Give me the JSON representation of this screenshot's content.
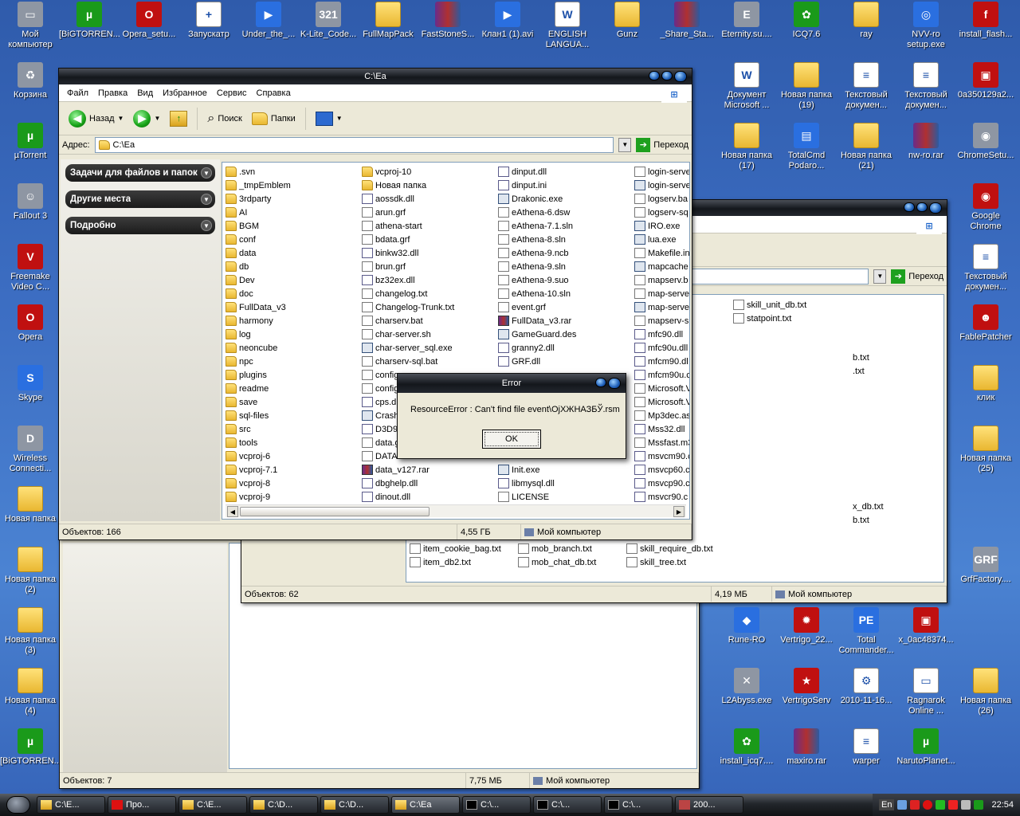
{
  "desktop": {
    "icons": [
      {
        "label": "Мой компьютер",
        "icon": "computer-icon",
        "cls": "gray",
        "glyph": "▭"
      },
      {
        "label": "[BiGTORREN...",
        "icon": "utorrent-icon",
        "cls": "green",
        "glyph": "µ"
      },
      {
        "label": "Opera_setu...",
        "icon": "opera-installer-icon",
        "cls": "red",
        "glyph": "O"
      },
      {
        "label": "Запускатр",
        "icon": "launcher-icon",
        "cls": "doc",
        "glyph": "+"
      },
      {
        "label": "Under_the_...",
        "icon": "media-file-icon",
        "cls": "blue",
        "glyph": "▶"
      },
      {
        "label": "K-Lite_Code...",
        "icon": "klite-icon",
        "cls": "gray",
        "glyph": "321"
      },
      {
        "label": "FullMapPack",
        "icon": "folder-icon",
        "cls": "folder",
        "glyph": ""
      },
      {
        "label": "FastStoneS...",
        "icon": "winrar-icon",
        "cls": "rar",
        "glyph": ""
      },
      {
        "label": "Клан1 (1).avi",
        "icon": "media-file-icon",
        "cls": "blue",
        "glyph": "▶"
      },
      {
        "label": "ENGLISH LANGUA...",
        "icon": "word-doc-icon",
        "cls": "doc",
        "glyph": "W"
      },
      {
        "label": "Gunz",
        "icon": "folder-icon",
        "cls": "folder",
        "glyph": ""
      },
      {
        "label": "_Share_Sta...",
        "icon": "winrar-icon",
        "cls": "rar",
        "glyph": ""
      },
      {
        "label": "Eternity.su....",
        "icon": "eternity-icon",
        "cls": "gray",
        "glyph": "E"
      },
      {
        "label": "ICQ7.6",
        "icon": "icq-icon",
        "cls": "green",
        "glyph": "✿"
      },
      {
        "label": "ray",
        "icon": "folder-icon",
        "cls": "folder",
        "glyph": ""
      },
      {
        "label": "NVV-ro setup.exe",
        "icon": "disc-icon",
        "cls": "blue",
        "glyph": "◎"
      },
      {
        "label": "install_flash...",
        "icon": "flash-icon",
        "cls": "red",
        "glyph": "f"
      },
      {
        "label": "Корзина",
        "icon": "recycle-bin-icon",
        "cls": "gray",
        "glyph": "♻"
      },
      {
        "label": "µTorrent",
        "icon": "utorrent-icon",
        "cls": "green",
        "glyph": "µ"
      },
      {
        "label": "Fallout 3",
        "icon": "fallout-icon",
        "cls": "gray",
        "glyph": "☺"
      },
      {
        "label": "Freemake Video C...",
        "icon": "freemake-icon",
        "cls": "red",
        "glyph": "V"
      },
      {
        "label": "Opera",
        "icon": "opera-icon",
        "cls": "red",
        "glyph": "O"
      },
      {
        "label": "Skype",
        "icon": "skype-icon",
        "cls": "blue",
        "glyph": "S"
      },
      {
        "label": "Wireless Connecti...",
        "icon": "dlink-icon",
        "cls": "gray",
        "glyph": "D"
      },
      {
        "label": "Новая папка",
        "icon": "folder-icon",
        "cls": "folder",
        "glyph": ""
      },
      {
        "label": "Новая папка (2)",
        "icon": "folder-icon",
        "cls": "folder",
        "glyph": ""
      },
      {
        "label": "Новая папка (3)",
        "icon": "folder-icon",
        "cls": "folder",
        "glyph": ""
      },
      {
        "label": "Новая папка (4)",
        "icon": "folder-icon",
        "cls": "folder",
        "glyph": ""
      },
      {
        "label": "[BiGTORREN...",
        "icon": "utorrent-icon",
        "cls": "green",
        "glyph": "µ"
      },
      {
        "label": "Документ Microsoft ...",
        "icon": "word-doc-icon",
        "cls": "doc",
        "glyph": "W"
      },
      {
        "label": "Новая папка (19)",
        "icon": "folder-icon",
        "cls": "folder",
        "glyph": ""
      },
      {
        "label": "Текстовый докумен...",
        "icon": "text-doc-icon",
        "cls": "doc",
        "glyph": "≡"
      },
      {
        "label": "Текстовый докумен...",
        "icon": "text-doc-icon",
        "cls": "doc",
        "glyph": "≡"
      },
      {
        "label": "0a350129a2...",
        "icon": "image-icon",
        "cls": "red",
        "glyph": "▣"
      },
      {
        "label": "Новая папка (17)",
        "icon": "folder-icon",
        "cls": "folder",
        "glyph": ""
      },
      {
        "label": "TotalCmd Podaro...",
        "icon": "floppy-icon",
        "cls": "blue",
        "glyph": "▤"
      },
      {
        "label": "Новая папка (21)",
        "icon": "folder-icon",
        "cls": "folder",
        "glyph": ""
      },
      {
        "label": "nw-ro.rar",
        "icon": "winrar-icon",
        "cls": "rar",
        "glyph": ""
      },
      {
        "label": "ChromeSetu...",
        "icon": "chrome-setup-icon",
        "cls": "gray",
        "glyph": "◉"
      },
      {
        "label": "Google Chrome",
        "icon": "chrome-icon",
        "cls": "red",
        "glyph": "◉"
      },
      {
        "label": "Текстовый докумен...",
        "icon": "text-doc-icon",
        "cls": "doc",
        "glyph": "≡"
      },
      {
        "label": "FablePatcher",
        "icon": "fable-icon",
        "cls": "red",
        "glyph": "☻"
      },
      {
        "label": "клик",
        "icon": "folder-icon",
        "cls": "folder",
        "glyph": ""
      },
      {
        "label": "Новая папка (25)",
        "icon": "folder-icon",
        "cls": "folder",
        "glyph": ""
      },
      {
        "label": "GrfFactory....",
        "icon": "grf-icon",
        "cls": "gray",
        "glyph": "GRF"
      },
      {
        "label": "Rune-RO",
        "icon": "rune-icon",
        "cls": "blue",
        "glyph": "◆"
      },
      {
        "label": "Vertrigo_22...",
        "icon": "gear-icon",
        "cls": "red",
        "glyph": "✹"
      },
      {
        "label": "Total Commander...",
        "icon": "pe-icon",
        "cls": "blue",
        "glyph": "PE"
      },
      {
        "label": "x_0ac48374...",
        "icon": "image-icon",
        "cls": "red",
        "glyph": "▣"
      },
      {
        "label": "L2Abyss.exe",
        "icon": "l2-icon",
        "cls": "gray",
        "glyph": "✕"
      },
      {
        "label": "VertrigoServ",
        "icon": "vertrigo-icon",
        "cls": "red",
        "glyph": "★"
      },
      {
        "label": "2010-11-16...",
        "icon": "settings-file-icon",
        "cls": "doc",
        "glyph": "⚙"
      },
      {
        "label": "Ragnarok Online ...",
        "icon": "window-icon",
        "cls": "doc",
        "glyph": "▭"
      },
      {
        "label": "Новая папка (26)",
        "icon": "folder-icon",
        "cls": "folder",
        "glyph": ""
      },
      {
        "label": "install_icq7....",
        "icon": "icq-icon",
        "cls": "green",
        "glyph": "✿"
      },
      {
        "label": "maxiro.rar",
        "icon": "winrar-icon",
        "cls": "rar",
        "glyph": ""
      },
      {
        "label": "warper",
        "icon": "text-doc-icon",
        "cls": "doc",
        "glyph": "≡"
      },
      {
        "label": "NarutoPlanet...",
        "icon": "utorrent-icon",
        "cls": "green",
        "glyph": "µ"
      }
    ]
  },
  "explorer_main": {
    "title": "C:\\Ea",
    "menu": [
      "Файл",
      "Правка",
      "Вид",
      "Избранное",
      "Сервис",
      "Справка"
    ],
    "back_label": "Назад",
    "search_label": "Поиск",
    "folders_label": "Папки",
    "address_label": "Адрес:",
    "address_value": "C:\\Ea",
    "go_label": "Переход",
    "task_sections": [
      "Задачи для файлов и папок",
      "Другие места",
      "Подробно"
    ],
    "columns": [
      [
        {
          "n": ".svn",
          "t": "folder"
        },
        {
          "n": "_tmpEmblem",
          "t": "folder"
        },
        {
          "n": "3rdparty",
          "t": "folder"
        },
        {
          "n": "AI",
          "t": "folder"
        },
        {
          "n": "BGM",
          "t": "folder"
        },
        {
          "n": "conf",
          "t": "folder"
        },
        {
          "n": "data",
          "t": "folder"
        },
        {
          "n": "db",
          "t": "folder"
        },
        {
          "n": "Dev",
          "t": "folder"
        },
        {
          "n": "doc",
          "t": "folder"
        },
        {
          "n": "FullData_v3",
          "t": "folder"
        },
        {
          "n": "harmony",
          "t": "folder"
        },
        {
          "n": "log",
          "t": "folder"
        },
        {
          "n": "neoncube",
          "t": "folder"
        },
        {
          "n": "npc",
          "t": "folder"
        },
        {
          "n": "plugins",
          "t": "folder"
        },
        {
          "n": "readme",
          "t": "folder"
        },
        {
          "n": "save",
          "t": "folder"
        },
        {
          "n": "sql-files",
          "t": "folder"
        },
        {
          "n": "src",
          "t": "folder"
        },
        {
          "n": "tools",
          "t": "folder"
        },
        {
          "n": "vcproj-6",
          "t": "folder"
        },
        {
          "n": "vcproj-7.1",
          "t": "folder"
        },
        {
          "n": "vcproj-8",
          "t": "folder"
        },
        {
          "n": "vcproj-9",
          "t": "folder"
        }
      ],
      [
        {
          "n": "vcproj-10",
          "t": "folder"
        },
        {
          "n": "Новая папка",
          "t": "folder"
        },
        {
          "n": "aossdk.dll",
          "t": "dll"
        },
        {
          "n": "arun.grf",
          "t": "file"
        },
        {
          "n": "athena-start",
          "t": "file"
        },
        {
          "n": "bdata.grf",
          "t": "file"
        },
        {
          "n": "binkw32.dll",
          "t": "dll"
        },
        {
          "n": "brun.grf",
          "t": "file"
        },
        {
          "n": "bz32ex.dll",
          "t": "dll"
        },
        {
          "n": "changelog.txt",
          "t": "file"
        },
        {
          "n": "Changelog-Trunk.txt",
          "t": "file"
        },
        {
          "n": "charserv.bat",
          "t": "file"
        },
        {
          "n": "char-server.sh",
          "t": "file"
        },
        {
          "n": "char-server_sql.exe",
          "t": "exe"
        },
        {
          "n": "charserv-sql.bat",
          "t": "file"
        },
        {
          "n": "configure",
          "t": "file"
        },
        {
          "n": "config",
          "t": "file"
        },
        {
          "n": "cps.dll",
          "t": "dll"
        },
        {
          "n": "Crash",
          "t": "exe"
        },
        {
          "n": "D3D9",
          "t": "dll"
        },
        {
          "n": "data.grf",
          "t": "file"
        },
        {
          "n": "DATA",
          "t": "file"
        },
        {
          "n": "data_v127.rar",
          "t": "rar"
        },
        {
          "n": "dbghelp.dll",
          "t": "dll"
        },
        {
          "n": "dinout.dll",
          "t": "dll"
        }
      ],
      [
        {
          "n": "dinput.dll",
          "t": "dll"
        },
        {
          "n": "dinput.ini",
          "t": "dll"
        },
        {
          "n": "Drakonic.exe",
          "t": "exe"
        },
        {
          "n": "eAthena-6.dsw",
          "t": "file"
        },
        {
          "n": "eAthena-7.1.sln",
          "t": "file"
        },
        {
          "n": "eAthena-8.sln",
          "t": "file"
        },
        {
          "n": "eAthena-9.ncb",
          "t": "file"
        },
        {
          "n": "eAthena-9.sln",
          "t": "file"
        },
        {
          "n": "eAthena-9.suo",
          "t": "file"
        },
        {
          "n": "eAthena-10.sln",
          "t": "file"
        },
        {
          "n": "event.grf",
          "t": "file"
        },
        {
          "n": "FullData_v3.rar",
          "t": "rar"
        },
        {
          "n": "GameGuard.des",
          "t": "exe"
        },
        {
          "n": "granny2.dll",
          "t": "dll"
        },
        {
          "n": "GRF.dll",
          "t": "dll"
        },
        {
          "n": "",
          "t": "none"
        },
        {
          "n": "",
          "t": "none"
        },
        {
          "n": "",
          "t": "none"
        },
        {
          "n": "",
          "t": "none"
        },
        {
          "n": "",
          "t": "none"
        },
        {
          "n": "",
          "t": "none"
        },
        {
          "n": "",
          "t": "none"
        },
        {
          "n": "Init.exe",
          "t": "exe"
        },
        {
          "n": "libmysql.dll",
          "t": "dll"
        },
        {
          "n": "LICENSE",
          "t": "file"
        }
      ],
      [
        {
          "n": "login-serve",
          "t": "file"
        },
        {
          "n": "login-serve",
          "t": "exe"
        },
        {
          "n": "logserv.ba",
          "t": "file"
        },
        {
          "n": "logserv-sq",
          "t": "file"
        },
        {
          "n": "IRO.exe",
          "t": "exe"
        },
        {
          "n": "lua.exe",
          "t": "exe"
        },
        {
          "n": "Makefile.in",
          "t": "file"
        },
        {
          "n": "mapcache",
          "t": "exe"
        },
        {
          "n": "mapserv.b",
          "t": "file"
        },
        {
          "n": "map-serve",
          "t": "file"
        },
        {
          "n": "map-serve",
          "t": "exe"
        },
        {
          "n": "mapserv-s",
          "t": "file"
        },
        {
          "n": "mfc90.dll",
          "t": "dll"
        },
        {
          "n": "mfc90u.dll",
          "t": "dll"
        },
        {
          "n": "mfcm90.dl",
          "t": "dll"
        },
        {
          "n": "mfcm90u.c",
          "t": "dll"
        },
        {
          "n": "Microsoft.V",
          "t": "file"
        },
        {
          "n": "Microsoft.V",
          "t": "file"
        },
        {
          "n": "Mp3dec.as",
          "t": "file"
        },
        {
          "n": "Mss32.dll",
          "t": "dll"
        },
        {
          "n": "Mssfast.m3",
          "t": "file"
        },
        {
          "n": "msvcm90.c",
          "t": "dll"
        },
        {
          "n": "msvcp60.c",
          "t": "dll"
        },
        {
          "n": "msvcp90.c",
          "t": "dll"
        },
        {
          "n": "msvcr90.c",
          "t": "dll"
        }
      ]
    ],
    "status_count": "Объектов: 166",
    "status_size": "4,55 ГБ",
    "status_location": "Мой компьютер"
  },
  "explorer_back": {
    "address_value": "",
    "go_label": "Переход",
    "items_col1": [
      {
        "n": "skill_unit_db.txt",
        "t": "file"
      },
      {
        "n": "statpoint.txt",
        "t": "file"
      }
    ],
    "bottom_rows": [
      [
        "item_cookie_bag.txt",
        "mob_branch.txt",
        "skill_require_db.txt"
      ],
      [
        "item_db2.txt",
        "mob_chat_db.txt",
        "skill_tree.txt"
      ]
    ],
    "partial_right": [
      "b.txt",
      ".txt",
      "x_db.txt",
      "b.txt"
    ],
    "status_count": "Объектов: 62",
    "status_size": "4,19 МБ",
    "status_location": "Мой компьютер"
  },
  "explorer_third": {
    "status_count": "Объектов: 7",
    "status_size": "7,75 МБ",
    "status_location": "Мой компьютер"
  },
  "error_dialog": {
    "title": "Error",
    "message": "ResourceError : Can't find file event\\ОјХЖНАЗБЎ.rsm",
    "ok_label": "OK"
  },
  "taskbar": {
    "tasks": [
      {
        "label": "C:\\E...",
        "icon": "folder-icon",
        "active": false
      },
      {
        "label": "Про...",
        "icon": "opera-icon",
        "active": false
      },
      {
        "label": "C:\\E...",
        "icon": "folder-icon",
        "active": false
      },
      {
        "label": "C:\\D...",
        "icon": "folder-icon",
        "active": false
      },
      {
        "label": "C:\\D...",
        "icon": "folder-icon",
        "active": false
      },
      {
        "label": "C:\\Ea",
        "icon": "folder-icon",
        "active": true
      },
      {
        "label": "C:\\...",
        "icon": "cmd-icon",
        "active": false
      },
      {
        "label": "C:\\...",
        "icon": "cmd-icon",
        "active": false
      },
      {
        "label": "C:\\...",
        "icon": "cmd-icon",
        "active": false
      },
      {
        "label": "200...",
        "icon": "ragnarok-icon",
        "active": false
      }
    ],
    "language": "En",
    "clock": "22:54"
  }
}
